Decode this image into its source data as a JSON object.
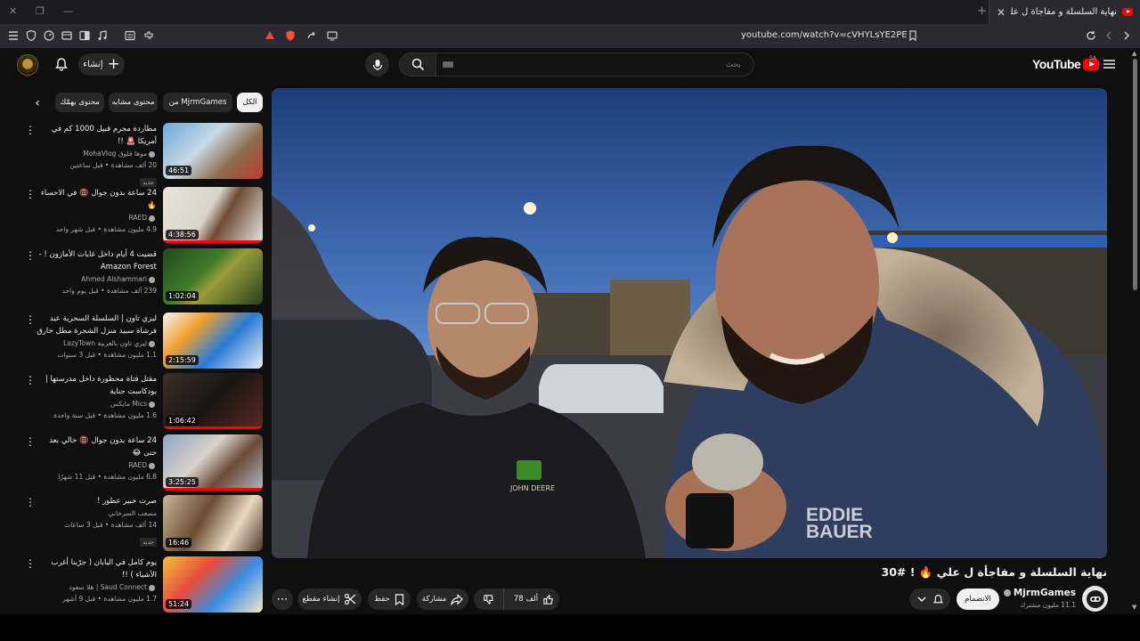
{
  "browser": {
    "tab_title": "نهاية السلسلة و مفاجأة ل علي 🔥 ! #30",
    "url": "youtube.com/watch?v=cVHYLsYE2PE"
  },
  "header": {
    "create_label": "إنشاء",
    "search_placeholder": "بحث",
    "logo_text": "YouTube",
    "logo_region": "SA"
  },
  "chips": [
    {
      "label": "الكل",
      "active": true
    },
    {
      "label": "من MjrmGames",
      "active": false
    },
    {
      "label": "محتوى مشابه",
      "active": false
    },
    {
      "label": "محتوى يهمّك",
      "active": false
    }
  ],
  "recommendations": [
    {
      "title": "مطاردة مجرم قبيل 1000 كم في أمريكا 🚨 !!",
      "channel": "موها فلوق MohaVlog",
      "meta": "20 ألف مشاهدة • قبل ساعتين",
      "badge": "جديد",
      "duration": "46:51"
    },
    {
      "title": "24 ساعة بدون جوال 📵 في الاحساء 🔥",
      "channel": "RAED",
      "meta": "4.9 مليون مشاهدة • قبل شهر واحد",
      "badge": "",
      "duration": "4:38:56"
    },
    {
      "title": "قضيت 4 أيام داخل غابات الأمازون ! - Amazon Forest",
      "channel": "Ahmed Alshammari",
      "meta": "239 ألف مشاهدة • قبل يوم واحد",
      "badge": "",
      "duration": "1:02:04"
    },
    {
      "title": "ليزي تاون | السلسلة السحرية عيد فرشاة سبيد منزل الشجرة مطل خارق جديد | ليزي تاون ...",
      "channel": "ليزي تاون بالعربية LazyTown",
      "meta": "1.1 مليون مشاهدة • قبل 3 سنوات",
      "badge": "",
      "duration": "2:15:59"
    },
    {
      "title": "مقتل فتاة محظورة داخل مدرستها | بودكاست جناية",
      "channel": "Mics مايكس",
      "meta": "1.6 مليون مشاهدة • قبل سنة واحدة",
      "badge": "",
      "duration": "1:06:42"
    },
    {
      "title": "24 ساعة بدون جوال 📵 خالي بعد حتى 😂",
      "channel": "RAED",
      "meta": "6.8 مليون مشاهدة • قبل 11 شهرًا",
      "badge": "",
      "duration": "3:25:25"
    },
    {
      "title": "صرت خبير عطور !",
      "channel": "مصعب السرحاني",
      "meta": "14 ألف مشاهدة • قبل 3 ساعات",
      "badge": "جديد",
      "duration": "16:46"
    },
    {
      "title": "يوم كامل في اليابان ( جرّبنا أغرب الأشياء ) !!",
      "channel": "Saud Connect | هلا سعود",
      "meta": "1.7 مليون مشاهدة • قبل 9 أشهر",
      "badge": "",
      "duration": "51:24"
    }
  ],
  "video": {
    "title": "نهاية السلسلة و مفاجأة ل علي 🔥 ! #30",
    "channel": "MjrmGames",
    "subscribers": "11.1 مليون مشترك",
    "join_label": "الانضمام",
    "like_count": "78 ألف",
    "share_label": "مشاركة",
    "save_label": "حفظ",
    "clip_label": "إنشاء مقطع",
    "overlay_texts": [
      "EDDIE",
      "BAUER",
      "JOHN DEERE"
    ]
  },
  "thumbnail_texts": [
    "الفتى",
    "تم",
    "24",
    "الامازون",
    "جـريـمـة في",
    "مدرسة بنات",
    "جناية",
    "ساعة",
    "سامري",
    "اليابان"
  ],
  "colors": {
    "accent": "#ff0000",
    "bg": "#0f0f0f",
    "chip": "#272727"
  }
}
